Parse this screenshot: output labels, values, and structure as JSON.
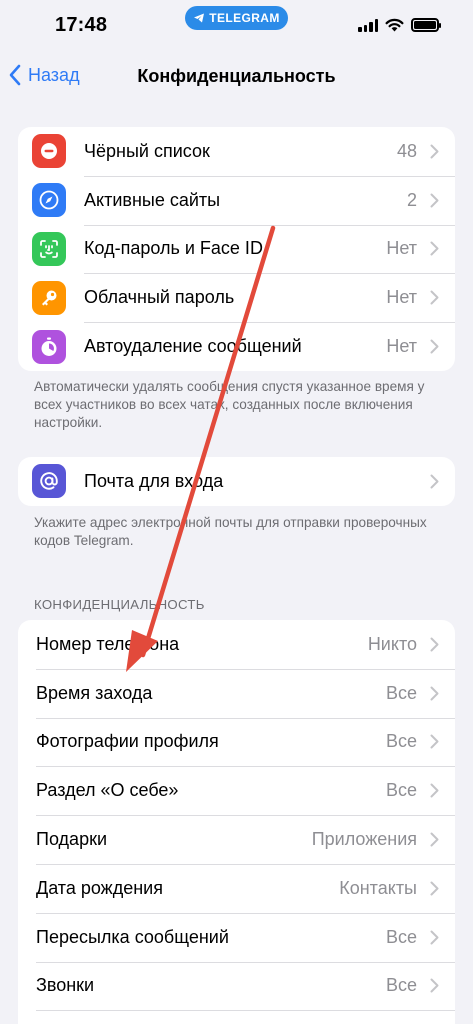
{
  "status_bar": {
    "time": "17:48",
    "pill": "TELEGRAM"
  },
  "nav": {
    "back_label": "Назад",
    "title": "Конфиденциальность"
  },
  "security_group": [
    {
      "icon": "minus-circle-icon",
      "color": "#ea4335",
      "label": "Чёрный список",
      "value": "48"
    },
    {
      "icon": "compass-icon",
      "color": "#2f7bf6",
      "label": "Активные сайты",
      "value": "2"
    },
    {
      "icon": "face-id-icon",
      "color": "#34c759",
      "label": "Код-пароль и Face ID",
      "value": "Нет"
    },
    {
      "icon": "key-icon",
      "color": "#ff9500",
      "label": "Облачный пароль",
      "value": "Нет"
    },
    {
      "icon": "timer-icon",
      "color": "#af52de",
      "label": "Автоудаление сообщений",
      "value": "Нет"
    }
  ],
  "security_footer": "Автоматически удалять сообщения спустя указанное время у всех участников во всех чатах, созданных после включения настройки.",
  "login_email": {
    "icon": "at-icon",
    "color": "#5856d6",
    "label": "Почта для входа"
  },
  "login_email_footer": "Укажите адрес электронной почты для отправки проверочных кодов Telegram.",
  "privacy_header": "КОНФИДЕНЦИАЛЬНОСТЬ",
  "privacy_group": [
    {
      "label": "Номер телефона",
      "value": "Никто"
    },
    {
      "label": "Время захода",
      "value": "Все"
    },
    {
      "label": "Фотографии профиля",
      "value": "Все"
    },
    {
      "label": "Раздел «О себе»",
      "value": "Все"
    },
    {
      "label": "Подарки",
      "value": "Приложения"
    },
    {
      "label": "Дата рождения",
      "value": "Контакты"
    },
    {
      "label": "Пересылка сообщений",
      "value": "Все"
    },
    {
      "label": "Звонки",
      "value": "Все"
    }
  ],
  "annotation": {
    "arrow_color": "#e24a3b"
  }
}
